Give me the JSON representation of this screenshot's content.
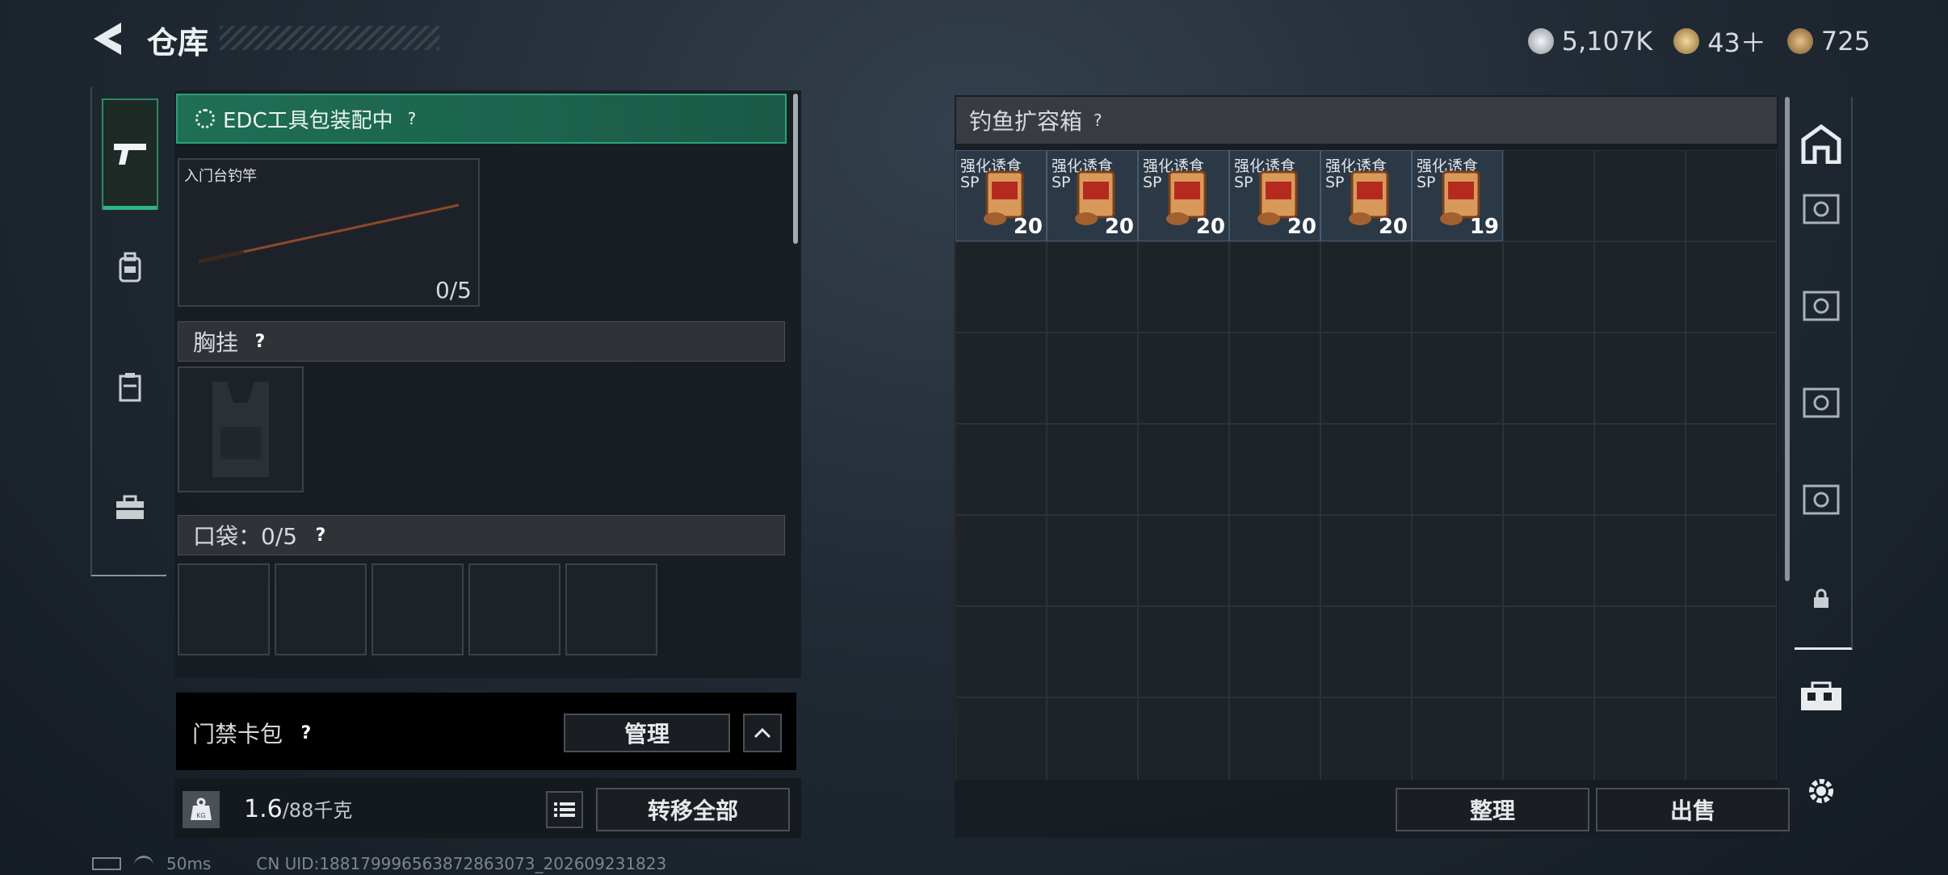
{
  "header": {
    "title": "仓库"
  },
  "currency": [
    {
      "icon": "silver-coin-icon",
      "value": "5,107K"
    },
    {
      "icon": "gold-triangle-icon",
      "value": "43＋"
    },
    {
      "icon": "bronze-coin-icon",
      "value": "725"
    }
  ],
  "left_tabs": [
    {
      "icon": "pistol-icon",
      "active": true
    },
    {
      "icon": "backpack-icon",
      "active": false
    },
    {
      "icon": "case-icon",
      "active": false
    },
    {
      "icon": "toolbox-icon",
      "active": false
    }
  ],
  "equip": {
    "edc_banner": "EDC工具包装配中",
    "rod_name": "入门台钓竿",
    "rod_count": "0/5",
    "vest_label": "胸挂",
    "pocket_label": "口袋：0/5",
    "pockets": 5,
    "keycard_label": "门禁卡包",
    "manage_label": "管理",
    "weight_current": "1.6",
    "weight_max": "/88千克",
    "transfer_all_label": "转移全部",
    "weight_icon": "KG"
  },
  "storage": {
    "title": "钓鱼扩容箱",
    "items": [
      {
        "name": "强化诱食",
        "sub": "SP",
        "count": "20"
      },
      {
        "name": "强化诱食",
        "sub": "SP",
        "count": "20"
      },
      {
        "name": "强化诱食",
        "sub": "SP",
        "count": "20"
      },
      {
        "name": "强化诱食",
        "sub": "SP",
        "count": "20"
      },
      {
        "name": "强化诱食",
        "sub": "SP",
        "count": "20"
      },
      {
        "name": "强化诱食",
        "sub": "SP",
        "count": "19"
      }
    ],
    "sort_label": "整理",
    "sell_label": "出售"
  },
  "status": {
    "ping": "50ms",
    "uid": "CN UID:18817999656387286307​3_202609231823"
  },
  "colors": {
    "accent_green": "#1f6f55",
    "panel": "#171c22",
    "item_blue": "#2b3846"
  }
}
